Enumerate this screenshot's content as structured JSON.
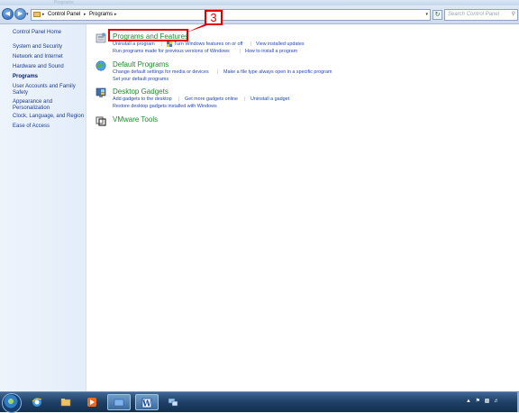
{
  "window": {
    "title": "Programs"
  },
  "address_bar": {
    "crumbs": [
      "Control Panel",
      "Programs"
    ],
    "search_placeholder": "Search Control Panel"
  },
  "sidebar": {
    "items": [
      {
        "label": "Control Panel Home"
      },
      {
        "label": "System and Security"
      },
      {
        "label": "Network and Internet"
      },
      {
        "label": "Hardware and Sound"
      },
      {
        "label": "Programs",
        "current": true
      },
      {
        "label": "User Accounts and Family Safety"
      },
      {
        "label": "Appearance and Personalization"
      },
      {
        "label": "Clock, Language, and Region"
      },
      {
        "label": "Ease of Access"
      }
    ]
  },
  "categories": [
    {
      "title": "Programs and Features",
      "icon": "programs-features-icon",
      "tasks_row1": [
        "Uninstall a program",
        "Turn Windows features on or off",
        "View installed updates"
      ],
      "tasks_row2": [
        "Run programs made for previous versions of Windows",
        "How to install a program"
      ]
    },
    {
      "title": "Default Programs",
      "icon": "default-programs-icon",
      "tasks_row1": [
        "Change default settings for media or devices",
        "Make a file type always open in a specific program"
      ],
      "tasks_row2": [
        "Set your default programs"
      ]
    },
    {
      "title": "Desktop Gadgets",
      "icon": "desktop-gadgets-icon",
      "tasks_row1": [
        "Add gadgets to the desktop",
        "Get more gadgets online",
        "Uninstall a gadget"
      ],
      "tasks_row2": [
        "Restore desktop gadgets installed with Windows"
      ]
    },
    {
      "title": "VMware Tools",
      "icon": "vmware-tools-icon"
    }
  ],
  "annotation": {
    "step_label": "3",
    "color": "#e00000"
  },
  "taskbar": {
    "apps": [
      "internet-explorer-icon",
      "windows-explorer-icon",
      "media-player-icon",
      "control-panel-icon",
      "word-icon",
      "network-icon"
    ]
  },
  "colors": {
    "category_title": "#1e8a2f",
    "task_link": "#2448b5",
    "nav_link": "#1c3d8f"
  }
}
